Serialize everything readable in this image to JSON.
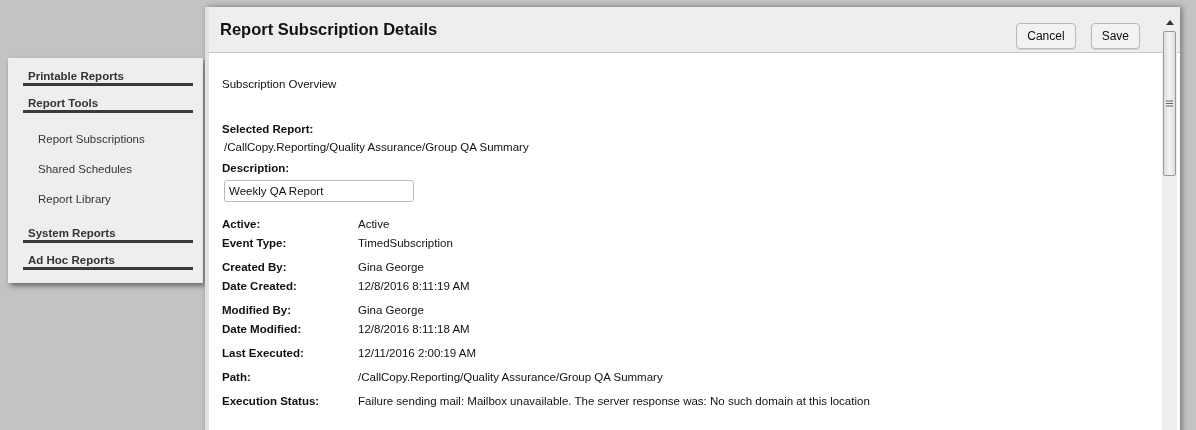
{
  "sidebar": {
    "sections": [
      {
        "label": "Printable Reports"
      },
      {
        "label": "Report Tools",
        "children": [
          {
            "label": "Report Subscriptions"
          },
          {
            "label": "Shared Schedules"
          },
          {
            "label": "Report Library"
          }
        ]
      },
      {
        "label": "System Reports"
      },
      {
        "label": "Ad Hoc Reports"
      }
    ]
  },
  "dialog": {
    "title": "Report Subscription Details",
    "buttons": [
      "Cancel",
      "Save"
    ],
    "overview": "Subscription Overview",
    "selected_report": {
      "label": "Selected Report:",
      "value": "/CallCopy.Reporting/Quality Assurance/Group QA Summary"
    },
    "description": {
      "label": "Description:",
      "value": "Weekly QA Report"
    },
    "field_groups": [
      [
        {
          "label": "Active:",
          "value": "Active"
        },
        {
          "label": "Event Type:",
          "value": "TimedSubscription"
        }
      ],
      [
        {
          "label": "Created By:",
          "value": "Gina George"
        },
        {
          "label": "Date Created:",
          "value": "12/8/2016 8:11:19 AM"
        }
      ],
      [
        {
          "label": "Modified By:",
          "value": "Gina George"
        },
        {
          "label": "Date Modified:",
          "value": "12/8/2016 8:11:18 AM"
        }
      ],
      [
        {
          "label": "Last Executed:",
          "value": "12/11/2016 2:00:19 AM"
        }
      ],
      [
        {
          "label": "Path:",
          "value": "/CallCopy.Reporting/Quality Assurance/Group QA Summary"
        }
      ],
      [
        {
          "label": "Execution Status:",
          "value": "Failure sending mail: Mailbox unavailable. The server response was: No such domain at this location"
        }
      ]
    ]
  }
}
